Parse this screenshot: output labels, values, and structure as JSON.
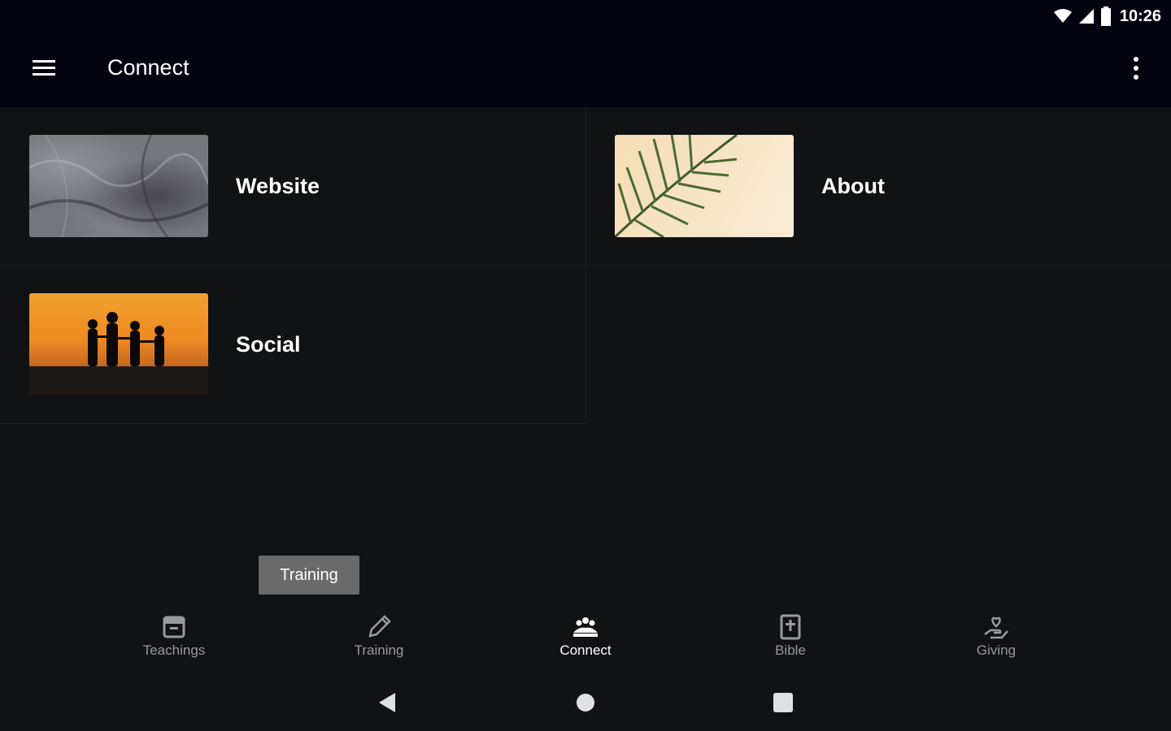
{
  "status_bar": {
    "time": "10:26"
  },
  "app_bar": {
    "title": "Connect"
  },
  "cards": [
    {
      "label": "Website"
    },
    {
      "label": "About"
    },
    {
      "label": "Social"
    }
  ],
  "tooltip": {
    "text": "Training"
  },
  "bottom_nav": {
    "items": [
      {
        "label": "Teachings",
        "icon": "archive-icon"
      },
      {
        "label": "Training",
        "icon": "pencil-icon"
      },
      {
        "label": "Connect",
        "icon": "group-icon",
        "active": true
      },
      {
        "label": "Bible",
        "icon": "bible-icon"
      },
      {
        "label": "Giving",
        "icon": "hand-heart-icon"
      }
    ]
  },
  "colors": {
    "background": "#111214",
    "app_bar": "#02030f",
    "inactive_label": "#9a9a9a",
    "tooltip": "#6a6a6a"
  }
}
